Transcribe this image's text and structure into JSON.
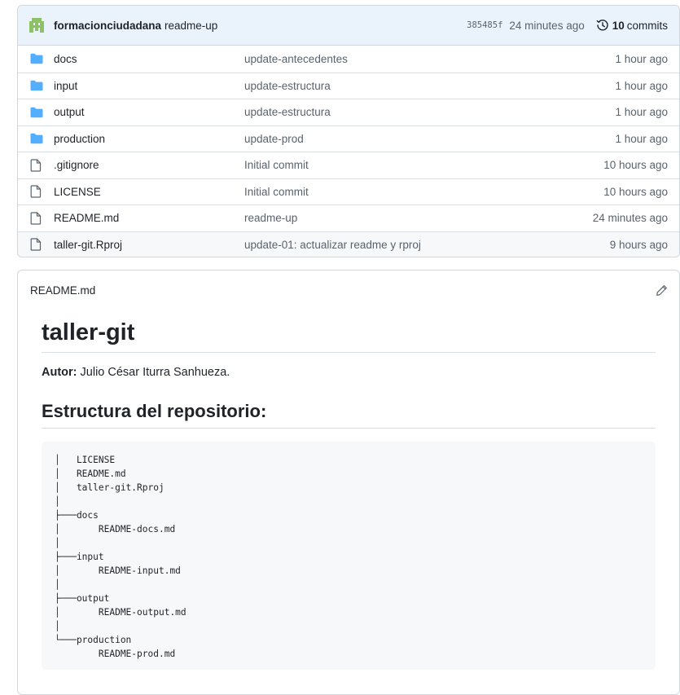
{
  "commit": {
    "author": "formacionciudadana",
    "message": "readme-up",
    "sha": "385485f",
    "time": "24 minutes ago",
    "commits_count": "10",
    "commits_label": "commits"
  },
  "files": [
    {
      "type": "folder",
      "icon": "folder-icon",
      "name": "docs",
      "message": "update-antecedentes",
      "time": "1 hour ago"
    },
    {
      "type": "folder",
      "icon": "folder-icon",
      "name": "input",
      "message": "update-estructura",
      "time": "1 hour ago"
    },
    {
      "type": "folder",
      "icon": "folder-icon",
      "name": "output",
      "message": "update-estructura",
      "time": "1 hour ago"
    },
    {
      "type": "folder",
      "icon": "folder-icon",
      "name": "production",
      "message": "update-prod",
      "time": "1 hour ago"
    },
    {
      "type": "file",
      "icon": "file-icon",
      "name": ".gitignore",
      "message": "Initial commit",
      "time": "10 hours ago"
    },
    {
      "type": "file",
      "icon": "file-icon",
      "name": "LICENSE",
      "message": "Initial commit",
      "time": "10 hours ago"
    },
    {
      "type": "file",
      "icon": "file-icon",
      "name": "README.md",
      "message": "readme-up",
      "time": "24 minutes ago"
    },
    {
      "type": "file",
      "icon": "file-icon",
      "name": "taller-git.Rproj",
      "message": "update-01: actualizar readme y rproj",
      "time": "9 hours ago"
    }
  ],
  "readme": {
    "filename": "README.md",
    "title": "taller-git",
    "author_label": "Autor:",
    "author_name": " Julio César Iturra Sanhueza.",
    "section_title": "Estructura del repositorio:",
    "tree": "│   LICENSE\n│   README.md\n│   taller-git.Rproj\n│\n├───docs\n│       README-docs.md\n│\n├───input\n│       README-input.md\n│\n├───output\n│       README-output.md\n│\n└───production\n        README-prod.md"
  },
  "colors": {
    "folder": "#54aeff",
    "file": "#59636e",
    "avatar": "#8cc265",
    "commit_bar": "#eaf2fb"
  }
}
